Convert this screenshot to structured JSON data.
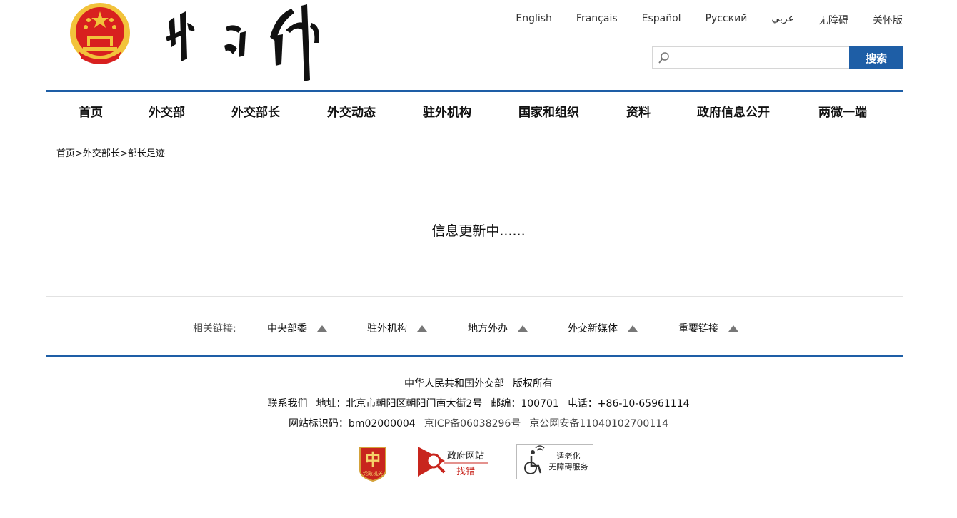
{
  "header": {
    "languages": [
      "English",
      "Français",
      "Español",
      "Русский",
      "عربي",
      "无障碍",
      "关怀版"
    ],
    "search": {
      "placeholder": "",
      "button_label": "搜索"
    }
  },
  "nav": {
    "items": [
      "首页",
      "外交部",
      "外交部长",
      "外交动态",
      "驻外机构",
      "国家和组织",
      "资料",
      "政府信息公开",
      "两微一端"
    ]
  },
  "breadcrumb": {
    "home": "首页",
    "sep": ">",
    "level1": "外交部长",
    "level2": "部长足迹"
  },
  "main": {
    "message": "信息更新中......"
  },
  "related_links": {
    "label": "相关链接:",
    "items": [
      "中央部委",
      "驻外机构",
      "地方外办",
      "外交新媒体",
      "重要链接"
    ]
  },
  "footer": {
    "owner": "中华人民共和国外交部",
    "copyright": "版权所有",
    "contact": "联系我们",
    "address": "地址：北京市朝阳区朝阳门南大街2号",
    "postcode": "邮编：100701",
    "phone": "电话：+86-10-65961114",
    "site_id": "网站标识码：bm02000004",
    "icp": "京ICP备06038296号",
    "police": "京公网安备11040102700114",
    "badges": {
      "party": "党政机关",
      "gov_error_line1": "政府网站",
      "gov_error_line2": "找错",
      "accessible_line1": "适老化",
      "accessible_line2": "无障碍服务"
    }
  },
  "colors": {
    "accent": "#1e5ea6",
    "emblem_red": "#d8201f",
    "emblem_gold": "#f2c33b"
  }
}
